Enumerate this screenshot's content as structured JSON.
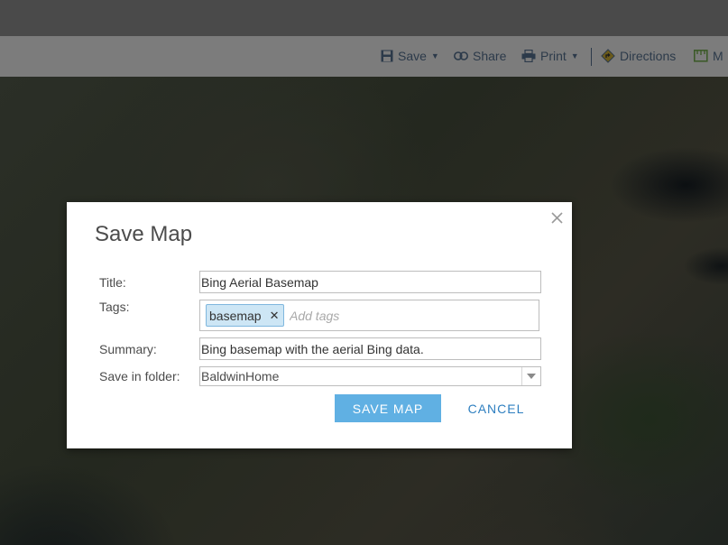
{
  "toolbar": {
    "save_label": "Save",
    "share_label": "Share",
    "print_label": "Print",
    "directions_label": "Directions",
    "measure_label": "M"
  },
  "dialog": {
    "title": "Save Map",
    "fields": {
      "title_label": "Title:",
      "title_value": "Bing Aerial Basemap",
      "tags_label": "Tags:",
      "tags": [
        "basemap"
      ],
      "tags_placeholder": "Add tags",
      "summary_label": "Summary:",
      "summary_value": "Bing basemap with the aerial Bing data.",
      "folder_label": "Save in folder:",
      "folder_value": "BaldwinHome"
    },
    "buttons": {
      "save": "SAVE MAP",
      "cancel": "CANCEL"
    }
  },
  "colors": {
    "primary_button": "#60b0e3",
    "link_button": "#2e7fc0",
    "tag_fill": "#cde6f5"
  }
}
